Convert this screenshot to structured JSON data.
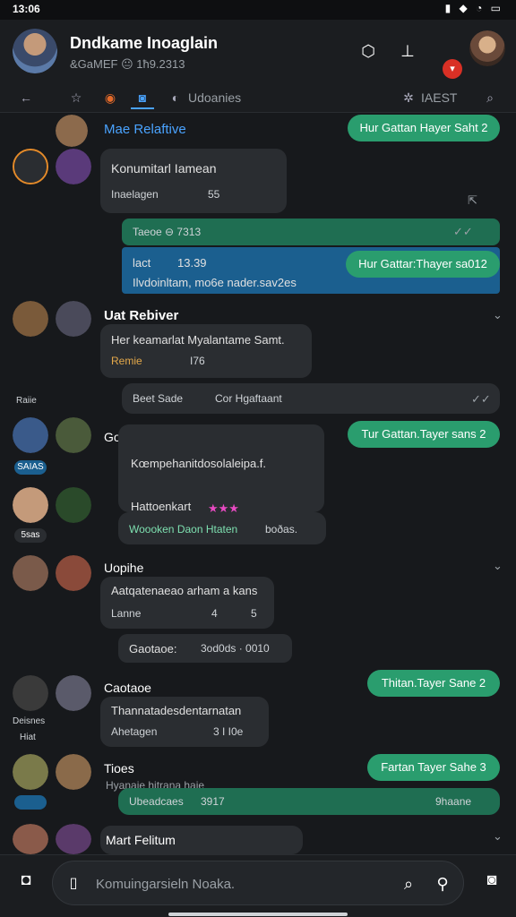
{
  "status": {
    "time": "13:06",
    "icons": "▮ ◆ ◔ ▭"
  },
  "header": {
    "title": "Dndkame Inoaglain",
    "subtitle": "&GaMEF 😐 1ħ9.2313",
    "red_badge": "▾"
  },
  "toolbar": {
    "tab_label": "Udoanies",
    "latest_label": "IAEST"
  },
  "feed": {
    "m1": {
      "name": "Mae Relaftive",
      "reply": "Hur Gattan Hayer Saht 2"
    },
    "m2": {
      "title": "Konumitarl Iamean",
      "meta": "Inaelagen",
      "count": "55"
    },
    "m3": {
      "top": "Taeoe ⊖ 7313",
      "label": "lact",
      "time": "13.39",
      "body": "Ilvdoinltam, mo6e nader.sav2es",
      "reply": "Hur Gattar:Thayer sa012"
    },
    "m4": {
      "name": "Uat Rebiver",
      "body": "Her keamarlat Myalantame Samt.",
      "meta": "Remie",
      "num": "I76"
    },
    "m5": {
      "text": "Beet Sade",
      "body": "Cor Hgaftaant",
      "side": "Raiie"
    },
    "m6": {
      "name": "Goopdarb",
      "body": "Kœmpehanitdosolaleipa.f.",
      "sub": "Hattoenkart",
      "stars": "★★★",
      "foot": "Woooken Daon Htaten",
      "foot2": "boðas.",
      "reply": "Tur Gattan.Tayer sans 2",
      "badge1": "SAIAS",
      "badge2": "5sas"
    },
    "m7": {
      "name": "Uopihe",
      "body": "Aatqatenaeao arham a kans",
      "meta": "Lanne",
      "num": "4",
      "n2": "5"
    },
    "m8": {
      "body": "Gaotaoe:",
      "tail": "3od0ds · 0010"
    },
    "m9": {
      "name": "Caotaoe",
      "body": "Thannatadesdentarnatan",
      "meta": "Ahetagen",
      "tail": "3 I I0e",
      "reply": "Thitan.Tayer Sane 2",
      "side": "Deisnes",
      "side2": "Hiat"
    },
    "m10": {
      "name": "Tioes",
      "body": "Ubeadcaes",
      "tail": "3917",
      "preview": "Hyanaie hitrana haie",
      "reply": "Fartan Tayer Sahe 3",
      "r2": "9haane"
    },
    "m11": {
      "name": "Mart Felitum"
    }
  },
  "composer": {
    "placeholder": "Komuingarsieln Noaka."
  },
  "colors": {
    "green": "#2a9d6e",
    "blue": "#1b5f8f",
    "accent": "#4aa3ff",
    "bg": "#17191c"
  }
}
